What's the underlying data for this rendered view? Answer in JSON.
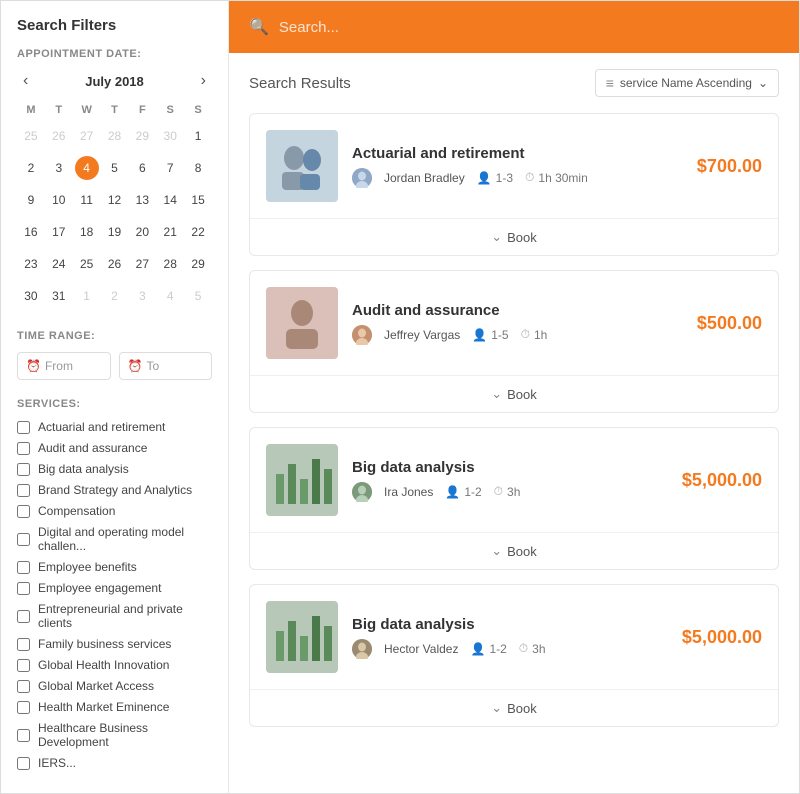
{
  "sidebar": {
    "title": "Search Filters",
    "appointment_date_label": "APPOINTMENT DATE:",
    "calendar": {
      "month_year": "July 2018",
      "day_headers": [
        "M",
        "T",
        "W",
        "T",
        "F",
        "S",
        "S"
      ],
      "weeks": [
        [
          {
            "day": "25",
            "other": true
          },
          {
            "day": "26",
            "other": true
          },
          {
            "day": "27",
            "other": true
          },
          {
            "day": "28",
            "other": true
          },
          {
            "day": "29",
            "other": true
          },
          {
            "day": "30",
            "other": true
          },
          {
            "day": "1"
          }
        ],
        [
          {
            "day": "2"
          },
          {
            "day": "3"
          },
          {
            "day": "4",
            "today": true
          },
          {
            "day": "5"
          },
          {
            "day": "6"
          },
          {
            "day": "7"
          },
          {
            "day": "8"
          }
        ],
        [
          {
            "day": "9"
          },
          {
            "day": "10"
          },
          {
            "day": "11"
          },
          {
            "day": "12"
          },
          {
            "day": "13"
          },
          {
            "day": "14"
          },
          {
            "day": "15"
          }
        ],
        [
          {
            "day": "16"
          },
          {
            "day": "17"
          },
          {
            "day": "18"
          },
          {
            "day": "19"
          },
          {
            "day": "20"
          },
          {
            "day": "21"
          },
          {
            "day": "22"
          }
        ],
        [
          {
            "day": "23"
          },
          {
            "day": "24"
          },
          {
            "day": "25"
          },
          {
            "day": "26"
          },
          {
            "day": "27"
          },
          {
            "day": "28"
          },
          {
            "day": "29"
          }
        ],
        [
          {
            "day": "30"
          },
          {
            "day": "31"
          },
          {
            "day": "1",
            "other": true
          },
          {
            "day": "2",
            "other": true
          },
          {
            "day": "3",
            "other": true
          },
          {
            "day": "4",
            "other": true
          },
          {
            "day": "5",
            "other": true
          }
        ]
      ]
    },
    "time_range_label": "TIME RANGE:",
    "from_placeholder": "From",
    "to_placeholder": "To",
    "services_label": "SERVICES:",
    "services": [
      "Actuarial and retirement",
      "Audit and assurance",
      "Big data analysis",
      "Brand Strategy and Analytics",
      "Compensation",
      "Digital and operating model challen...",
      "Employee benefits",
      "Employee engagement",
      "Entrepreneurial and private clients",
      "Family business services",
      "Global Health Innovation",
      "Global Market Access",
      "Health Market Eminence",
      "Healthcare Business Development",
      "IERS..."
    ]
  },
  "main": {
    "search_placeholder": "Search...",
    "results_title": "Search Results",
    "sort_label": "service Name Ascending",
    "sort_icon": "≡",
    "results": [
      {
        "title": "Actuarial and retirement",
        "provider": "Jordan Bradley",
        "capacity": "1-3",
        "duration": "1h 30min",
        "price": "$700.00",
        "book_label": "Book",
        "image_bg": "#b8c9d9"
      },
      {
        "title": "Audit and assurance",
        "provider": "Jeffrey Vargas",
        "capacity": "1-5",
        "duration": "1h",
        "price": "$500.00",
        "book_label": "Book",
        "image_bg": "#c9b8b8"
      },
      {
        "title": "Big data analysis",
        "provider": "Ira Jones",
        "capacity": "1-2",
        "duration": "3h",
        "price": "$5,000.00",
        "book_label": "Book",
        "image_bg": "#b8c4b8"
      },
      {
        "title": "Big data analysis",
        "provider": "Hector Valdez",
        "capacity": "1-2",
        "duration": "3h",
        "price": "$5,000.00",
        "book_label": "Book",
        "image_bg": "#b8c4b8"
      }
    ]
  },
  "colors": {
    "accent": "#f47a20",
    "text_primary": "#333",
    "text_secondary": "#777"
  }
}
